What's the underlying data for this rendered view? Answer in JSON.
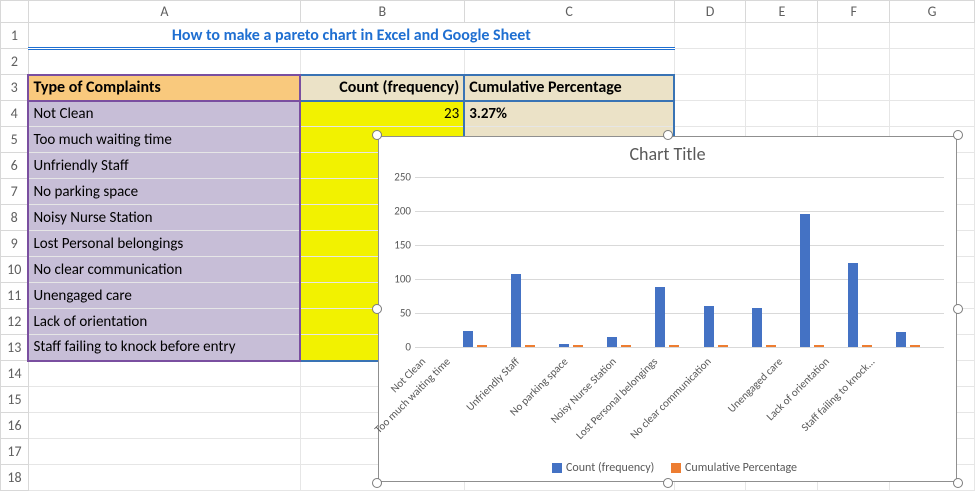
{
  "columns": [
    "A",
    "B",
    "C",
    "D",
    "E",
    "F",
    "G"
  ],
  "row_count": 18,
  "title": "How to make a pareto chart in Excel and Google Sheet",
  "headers": {
    "a": "Type of Complaints",
    "b": "Count (frequency)",
    "c": "Cumulative Percentage"
  },
  "rows": [
    {
      "type": "Not Clean",
      "count": "23",
      "cum": "3.27%"
    },
    {
      "type": "Too much waiting time",
      "count": "",
      "cum": ""
    },
    {
      "type": "Unfriendly Staff",
      "count": "",
      "cum": ""
    },
    {
      "type": "No parking space",
      "count": "",
      "cum": ""
    },
    {
      "type": "Noisy Nurse Station",
      "count": "",
      "cum": ""
    },
    {
      "type": "Lost Personal belongings",
      "count": "",
      "cum": ""
    },
    {
      "type": "No clear communication",
      "count": "",
      "cum": ""
    },
    {
      "type": "Unengaged care",
      "count": "",
      "cum": ""
    },
    {
      "type": "Lack of orientation",
      "count": "",
      "cum": ""
    },
    {
      "type": "Staff failing to knock before entry",
      "count": "",
      "cum": ""
    }
  ],
  "chart": {
    "title": "Chart Title",
    "legend": {
      "s1": "Count (frequency)",
      "s2": "Cumulative Percentage"
    },
    "ylim": [
      0,
      250
    ],
    "yticks": [
      0,
      50,
      100,
      150,
      200,
      250
    ]
  },
  "chart_data": {
    "type": "bar",
    "title": "Chart Title",
    "xlabel": "",
    "ylabel": "",
    "ylim": [
      0,
      250
    ],
    "categories": [
      "Not Clean",
      "Too much waiting time",
      "Unfriendly Staff",
      "No parking space",
      "Noisy Nurse Station",
      "Lost Personal belongings",
      "No clear communication",
      "Unengaged care",
      "Lack of orientation",
      "Staff failing to knock..."
    ],
    "series": [
      {
        "name": "Count (frequency)",
        "values": [
          23,
          108,
          5,
          15,
          88,
          60,
          58,
          195,
          123,
          22
        ]
      },
      {
        "name": "Cumulative Percentage",
        "values": [
          3,
          3,
          3,
          3,
          3,
          3,
          3,
          3,
          3,
          3
        ]
      }
    ],
    "legend_position": "bottom",
    "grid": true
  }
}
